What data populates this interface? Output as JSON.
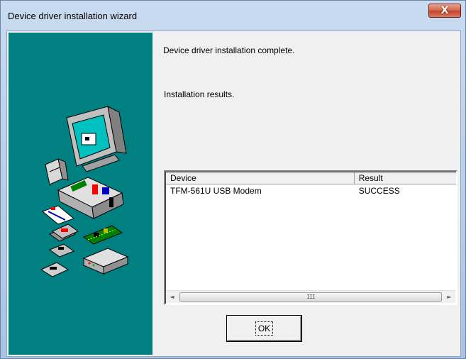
{
  "window": {
    "title": "Device driver installation wizard",
    "close_glyph": "X"
  },
  "content": {
    "complete_message": "Device driver installation complete.",
    "results_label": "Installation results."
  },
  "results_table": {
    "columns": [
      "Device",
      "Result"
    ],
    "rows": [
      {
        "device": "TFM-561U USB Modem",
        "result": "SUCCESS"
      }
    ]
  },
  "scrollbar": {
    "left_arrow": "◄",
    "right_arrow": "►",
    "grip": "III"
  },
  "buttons": {
    "ok_label": "OK"
  },
  "colors": {
    "side_panel": "#008080",
    "dialog_face": "#f0f0f0"
  }
}
